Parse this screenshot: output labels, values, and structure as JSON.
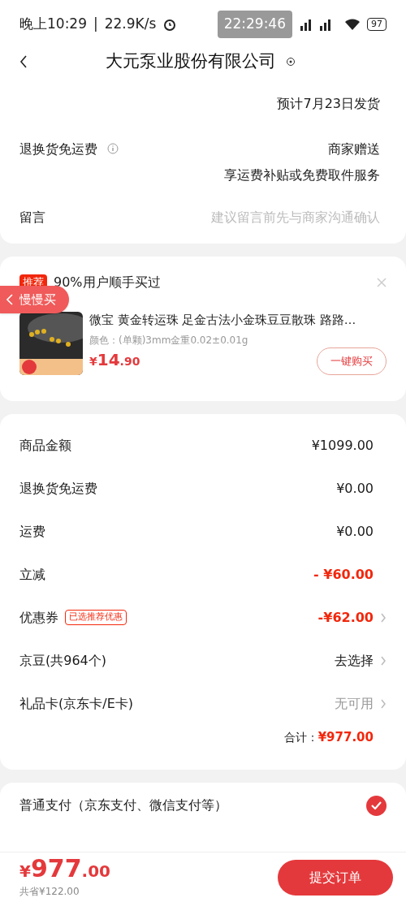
{
  "status_bar": {
    "time": "晚上10:29",
    "separator": "|",
    "speed": "22.9K/s",
    "clock_overlay": "22:29:46",
    "battery": "97"
  },
  "header": {
    "title": "大元泵业股份有限公司"
  },
  "delivery": {
    "date": "预计7月23日发货"
  },
  "return_shipping": {
    "label": "退换货免运费",
    "value": "商家赠送",
    "note": "享运费补贴或免费取件服务"
  },
  "message": {
    "label": "留言",
    "placeholder": "建议留言前先与商家沟通确认"
  },
  "recommend": {
    "badge": "推荐",
    "title": "90%用户顺手买过",
    "slow_buy": "慢慢买",
    "product": {
      "name": "微宝 黄金转运珠 足金古法小金珠豆豆散珠 路路…",
      "spec": "颜色：(单颗)3mm金重0.02±0.01g",
      "currency": "¥",
      "price_int": "14",
      "price_dec": ".90",
      "button": "一键购买"
    }
  },
  "price_rows": [
    {
      "label": "商品金额",
      "value": "¥1099.00",
      "kind": "plain",
      "arrow": false
    },
    {
      "label": "退换货免运费",
      "value": "¥0.00",
      "kind": "plain",
      "arrow": false
    },
    {
      "label": "运费",
      "value": "¥0.00",
      "kind": "plain",
      "arrow": false
    },
    {
      "label": "立减",
      "value": "- ¥60.00",
      "kind": "discount",
      "arrow": false
    },
    {
      "label": "优惠券",
      "tag": "已选推荐优惠",
      "value": "-¥62.00",
      "kind": "discount",
      "arrow": true
    },
    {
      "label": "京豆(共964个)",
      "value": "去选择",
      "kind": "plain",
      "arrow": true
    },
    {
      "label": "礼品卡(京东卡/E卡)",
      "value": "无可用",
      "kind": "unavailable",
      "arrow": true
    }
  ],
  "total": {
    "label": "合计：",
    "value": "¥977.00"
  },
  "payment": {
    "label": "普通支付（京东支付、微信支付等）",
    "checked": true
  },
  "footer": {
    "currency": "¥",
    "amount_int": "977",
    "amount_dec": ".00",
    "saved": "共省¥122.00",
    "submit": "提交订单"
  }
}
